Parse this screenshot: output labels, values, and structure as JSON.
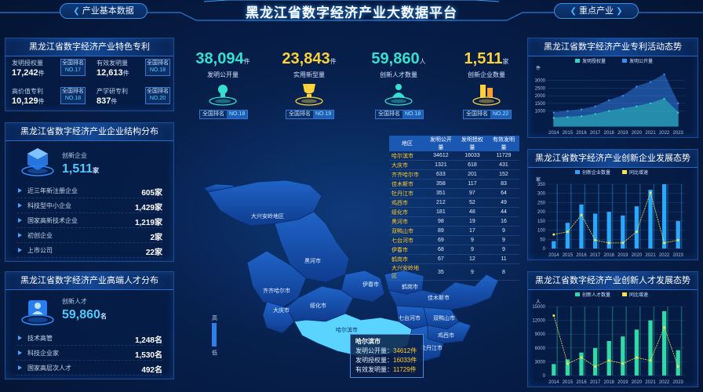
{
  "header": {
    "title": "黑龙江省数字经济产业大数据平台",
    "left_button": "产业基本数据",
    "right_button": "重点产业"
  },
  "panel_patent": {
    "title": "黑龙江省数字经济产业特色专利",
    "items": [
      {
        "label": "发明授权量",
        "value": "17,242",
        "unit": "件",
        "rank_label": "全国排名",
        "rank": "NO.17"
      },
      {
        "label": "有效发明量",
        "value": "12,613",
        "unit": "件",
        "rank_label": "全国排名",
        "rank": "NO.18"
      },
      {
        "label": "高价值专利",
        "value": "10,129",
        "unit": "件",
        "rank_label": "全国排名",
        "rank": "NO.18"
      },
      {
        "label": "产学研专利",
        "value": "837",
        "unit": "件",
        "rank_label": "全国排名",
        "rank": "NO.20"
      }
    ]
  },
  "panel_enterprise": {
    "title": "黑龙江省数字经济产业企业结构分布",
    "main_label": "创新企业",
    "main_value": "1,511",
    "main_unit": "家",
    "rows": [
      {
        "label": "近三年新注册企业",
        "value": "605家"
      },
      {
        "label": "科技型中小企业",
        "value": "1,429家"
      },
      {
        "label": "国家高新技术企业",
        "value": "1,219家"
      },
      {
        "label": "初创企业",
        "value": "2家"
      },
      {
        "label": "上市公司",
        "value": "22家"
      }
    ]
  },
  "panel_talent": {
    "title": "黑龙江省数字经济产业高端人才分布",
    "main_label": "创新人才",
    "main_value": "59,860",
    "main_unit": "名",
    "rows": [
      {
        "label": "技术高管",
        "value": "1,248名"
      },
      {
        "label": "科技企业家",
        "value": "1,530名"
      },
      {
        "label": "国家高层次人才",
        "value": "492名"
      }
    ]
  },
  "kpis": [
    {
      "value": "38,094",
      "unit": "件",
      "label": "发明公开量",
      "rank_label": "全国排名",
      "rank": "NO.18",
      "color": "#35e0d0",
      "icon": "bulb-icon"
    },
    {
      "value": "23,843",
      "unit": "件",
      "label": "实用新型量",
      "rank_label": "全国排名",
      "rank": "NO.19",
      "color": "#ffd23a",
      "icon": "trophy-icon"
    },
    {
      "value": "59,860",
      "unit": "人",
      "label": "创新人才数量",
      "rank_label": "全国排名",
      "rank": "NO.18",
      "color": "#35e0d0",
      "icon": "person-icon"
    },
    {
      "value": "1,511",
      "unit": "家",
      "label": "创新企业数量",
      "rank_label": "全国排名",
      "rank": "NO.22",
      "color": "#ffd23a",
      "icon": "building-icon"
    }
  ],
  "region_table": {
    "headers": [
      "地区",
      "发明公开量",
      "发明授权量",
      "有效发明量"
    ],
    "rows": [
      [
        "哈尔滨市",
        "34612",
        "16033",
        "11729"
      ],
      [
        "大庆市",
        "1321",
        "618",
        "431"
      ],
      [
        "齐齐哈尔市",
        "633",
        "201",
        "152"
      ],
      [
        "佳木斯市",
        "358",
        "117",
        "83"
      ],
      [
        "牡丹江市",
        "351",
        "97",
        "64"
      ],
      [
        "鸡西市",
        "212",
        "52",
        "49"
      ],
      [
        "绥化市",
        "181",
        "48",
        "44"
      ],
      [
        "黑河市",
        "98",
        "19",
        "16"
      ],
      [
        "双鸭山市",
        "89",
        "17",
        "9"
      ],
      [
        "七台河市",
        "69",
        "9",
        "9"
      ],
      [
        "伊春市",
        "68",
        "9",
        "9"
      ],
      [
        "鹤岗市",
        "67",
        "12",
        "11"
      ],
      [
        "大兴安岭地区",
        "35",
        "9",
        "8"
      ]
    ]
  },
  "map": {
    "labels": [
      "大兴安岭地区",
      "黑河市",
      "齐齐哈尔市",
      "伊春市",
      "鹤岗市",
      "大庆市",
      "绥化市",
      "佳木斯市",
      "双鸭山市",
      "七台河市",
      "鸡西市",
      "哈尔滨市",
      "牡丹江市"
    ],
    "legend_high": "高",
    "legend_low": "低",
    "tooltip": {
      "title": "哈尔滨市",
      "rows": [
        {
          "label": "发明公开量：",
          "value": "34612件"
        },
        {
          "label": "发明授权量：",
          "value": "16033件"
        },
        {
          "label": "有效发明量：",
          "value": "11729件"
        }
      ]
    }
  },
  "chart_titles": {
    "patent_trend": "黑龙江省数字经济产业专利活动态势",
    "enterprise_trend": "黑龙江省数字经济产业创新企业发展态势",
    "talent_trend": "黑龙江省数字经济产业创新人才发展态势"
  },
  "chart_data": [
    {
      "type": "area",
      "title": "黑龙江省数字经济产业专利活动态势",
      "ylabel": "件",
      "categories": [
        "2014",
        "2015",
        "2016",
        "2017",
        "2018",
        "2019",
        "2020",
        "2021",
        "2022",
        "2023"
      ],
      "series": [
        {
          "name": "发明授权量",
          "values": [
            550,
            600,
            650,
            800,
            1000,
            1150,
            1300,
            1500,
            1800,
            900
          ],
          "color": "#2fd6c6"
        },
        {
          "name": "发明公开量",
          "values": [
            900,
            1000,
            1100,
            1300,
            1700,
            2000,
            2600,
            2900,
            3400,
            1500
          ],
          "color": "#3a8fff"
        }
      ],
      "yticks": [
        1000,
        1500,
        2000,
        2500,
        3000
      ],
      "ylim": [
        0,
        3500
      ]
    },
    {
      "type": "bar",
      "title": "黑龙江省数字经济产业创新企业发展态势",
      "ylabel": "家",
      "categories": [
        "2014",
        "2015",
        "2016",
        "2017",
        "2018",
        "2019",
        "2020",
        "2021",
        "2022",
        "2023"
      ],
      "series": [
        {
          "name": "创新企业数量",
          "values": [
            40,
            140,
            240,
            190,
            200,
            180,
            230,
            320,
            350,
            150
          ],
          "color": "#2aa8ff"
        },
        {
          "name": "同比增速",
          "values": [
            5,
            6,
            12,
            3,
            2,
            2,
            6,
            20,
            2,
            3
          ],
          "color": "#ffe24a",
          "axis": "right"
        }
      ],
      "yticks": [
        0,
        50,
        100,
        150,
        200,
        250,
        300,
        350
      ],
      "ylim": [
        0,
        350
      ]
    },
    {
      "type": "bar",
      "title": "黑龙江省数字经济产业创新人才发展态势",
      "ylabel": "人",
      "categories": [
        "2014",
        "2015",
        "2016",
        "2017",
        "2018",
        "2019",
        "2020",
        "2021",
        "2022",
        "2023"
      ],
      "series": [
        {
          "name": "创新人才数量",
          "values": [
            2500,
            3500,
            5000,
            6000,
            7500,
            8500,
            10000,
            12000,
            14000,
            5500
          ],
          "color": "#31d8a8"
        },
        {
          "name": "同比增速",
          "values": [
            20,
            4,
            6,
            3,
            5,
            4,
            6,
            5,
            16,
            3
          ],
          "color": "#ffe24a",
          "axis": "right"
        }
      ],
      "yticks": [
        0,
        3000,
        6000,
        9000,
        12000,
        15000
      ],
      "ylim": [
        0,
        15000
      ]
    }
  ]
}
